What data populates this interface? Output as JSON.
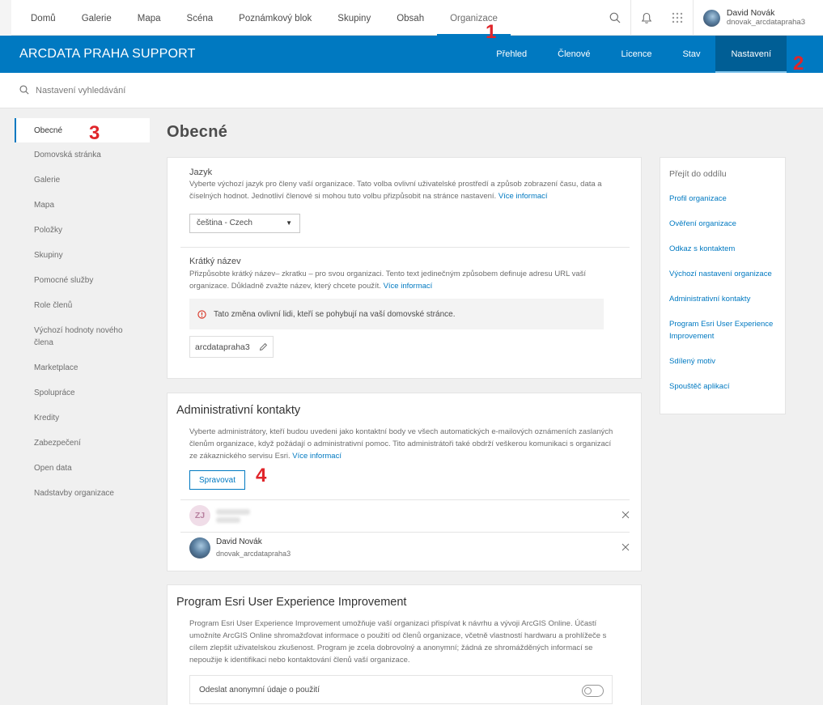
{
  "topnav": {
    "links": [
      "Domů",
      "Galerie",
      "Mapa",
      "Scéna",
      "Poznámkový blok",
      "Skupiny",
      "Obsah",
      "Organizace"
    ],
    "active_link": "Organizace",
    "icons": [
      "search-icon",
      "bell-icon",
      "apps-grid-icon"
    ],
    "user": {
      "name": "David Novák",
      "login": "dnovak_arcdatapraha3"
    }
  },
  "org": {
    "title": "ARCDATA PRAHA SUPPORT",
    "tabs": [
      "Přehled",
      "Členové",
      "Licence",
      "Stav",
      "Nastavení"
    ],
    "active_tab": "Nastavení"
  },
  "search": {
    "placeholder": "Nastavení vyhledávání"
  },
  "sidebar": {
    "items": [
      "Obecné",
      "Domovská stránka",
      "Galerie",
      "Mapa",
      "Položky",
      "Skupiny",
      "Pomocné služby",
      "Role členů",
      "Výchozí hodnoty nového člena",
      "Marketplace",
      "Spolupráce",
      "Kredity",
      "Zabezpečení",
      "Open data",
      "Nadstavby organizace"
    ],
    "active": "Obecné"
  },
  "page": {
    "title": "Obecné"
  },
  "language": {
    "label": "Jazyk",
    "desc": "Vyberte výchozí jazyk pro členy vaší organizace. Tato volba ovlivní uživatelské prostředí a způsob zobrazení času, data a číselných hodnot. Jednotliví členové si mohou tuto volbu přizpůsobit na stránce nastavení.",
    "more": "Více informací",
    "selected": "čeština - Czech"
  },
  "short_name": {
    "label": "Krátký název",
    "desc": "Přizpůsobte krátký název– zkratku – pro svou organizaci. Tento text jedinečným způsobem definuje adresu URL vaší organizace. Důkladně zvažte název, který chcete použít.",
    "more": "Více informací",
    "warning": "Tato změna ovlivní lidi, kteří se pohybují na vaší domovské stránce.",
    "value": "arcdatapraha3"
  },
  "admin_contacts": {
    "title": "Administrativní kontakty",
    "desc": "Vyberte administrátory, kteří budou uvedeni jako kontaktní body ve všech automatických e-mailových oznámeních zaslaných členům organizace, když požádají o administrativní pomoc. Tito administrátoři také obdrží veškerou komunikaci s organizací ze zákaznického servisu Esri.",
    "more": "Více informací",
    "manage_label": "Spravovat",
    "contacts": [
      {
        "initials": "ZJ",
        "name": "",
        "login": ""
      },
      {
        "initials": "",
        "name": "David Novák",
        "login": "dnovak_arcdatapraha3"
      }
    ]
  },
  "ux_program": {
    "title": "Program Esri User Experience Improvement",
    "desc": "Program Esri User Experience Improvement umožňuje vaší organizaci přispívat k návrhu a vývoji ArcGIS Online. Účastí umožníte ArcGIS Online shromažďovat informace o použití od členů organizace, včetně vlastností hardwaru a prohlížeče s cílem zlepšit uživatelskou zkušenost. Program je zcela dobrovolný a anonymní; žádná ze shromážděných informací se nepoužije k identifikaci nebo kontaktování členů vaší organizace.",
    "toggle_label": "Odeslat anonymní údaje o použití",
    "toggle_on": false
  },
  "jump": {
    "title": "Přejít do oddílu",
    "links": [
      "Profil organizace",
      "Ověření organizace",
      "Odkaz s kontaktem",
      "Výchozí nastavení organizace",
      "Administrativní kontakty",
      "Program Esri User Experience Improvement",
      "Sdílený motiv",
      "Spouštěč aplikací"
    ]
  },
  "annotations": [
    "1",
    "2",
    "3",
    "4"
  ],
  "colors": {
    "brand_blue": "#0079c1",
    "active_tab_bg": "#005e95",
    "annotation_red": "#e0252a"
  }
}
